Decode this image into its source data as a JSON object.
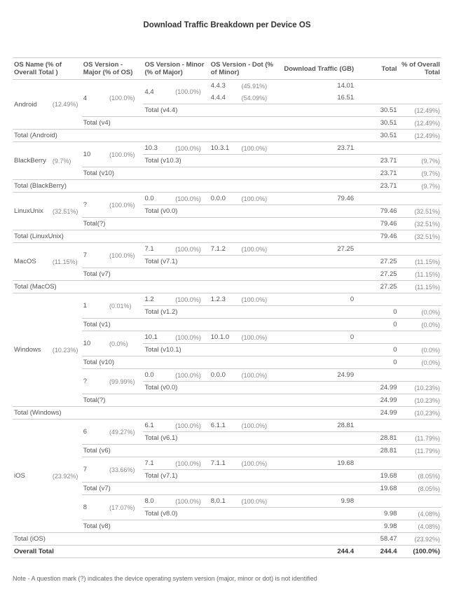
{
  "title": "Download Traffic Breakdown per Device OS",
  "headers": {
    "os_name": "OS Name  (% of Overall Total )",
    "major": "OS Version - Major (% of OS)",
    "minor": "OS Version - Minor (% of Major)",
    "dot": "OS Version - Dot (% of Minor)",
    "traffic": "Download Traffic (GB)",
    "total": "Total",
    "pct_overall": "% of Overall Total"
  },
  "chart_data": {
    "type": "table",
    "title": "Download Traffic Breakdown per Device OS",
    "os": [
      {
        "name": "Android",
        "pct_overall": "(12.49%)",
        "majors": [
          {
            "v": "4",
            "pct": "(100.0%)",
            "minors": [
              {
                "v": "4.4",
                "pct": "(100.0%)",
                "dots": [
                  {
                    "v": "4.4.3",
                    "pct": "(45.91%)",
                    "traffic": "14.01"
                  },
                  {
                    "v": "4.4.4",
                    "pct": "(54.09%)",
                    "traffic": "16.51"
                  }
                ],
                "total_label": "Total (v4.4)",
                "total_val": "30.51",
                "total_pct": "(12.49%)"
              }
            ],
            "total_label": "Total (v4)",
            "total_val": "30.51",
            "total_pct": "(12.49%)"
          }
        ],
        "total_label": "Total (Android)",
        "total_val": "30.51",
        "total_pct": "(12.49%)"
      },
      {
        "name": "BlackBerry",
        "pct_overall": "(9.7%)",
        "majors": [
          {
            "v": "10",
            "pct": "(100.0%)",
            "minors": [
              {
                "v": "10.3",
                "pct": "(100.0%)",
                "dots": [
                  {
                    "v": "10.3.1",
                    "pct": "(100.0%)",
                    "traffic": "23.71"
                  }
                ],
                "total_label": "Total (v10.3)",
                "total_val": "23.71",
                "total_pct": "(9.7%)"
              }
            ],
            "total_label": "Total (v10)",
            "total_val": "23.71",
            "total_pct": "(9.7%)"
          }
        ],
        "total_label": "Total (BlackBerry)",
        "total_val": "23.71",
        "total_pct": "(9.7%)"
      },
      {
        "name": "LinuxUnix",
        "pct_overall": "(32.51%)",
        "majors": [
          {
            "v": "?",
            "pct": "(100.0%)",
            "minors": [
              {
                "v": "0.0",
                "pct": "(100.0%)",
                "dots": [
                  {
                    "v": "0.0.0",
                    "pct": "(100.0%)",
                    "traffic": "79.46"
                  }
                ],
                "total_label": "Total (v0.0)",
                "total_val": "79.46",
                "total_pct": "(32.51%)"
              }
            ],
            "total_label": "Total(?)",
            "total_val": "79.46",
            "total_pct": "(32.51%)"
          }
        ],
        "total_label": "Total (LinuxUnix)",
        "total_val": "79.46",
        "total_pct": "(32.51%)"
      },
      {
        "name": "MacOS",
        "pct_overall": "(11.15%)",
        "majors": [
          {
            "v": "7",
            "pct": "(100.0%)",
            "minors": [
              {
                "v": "7.1",
                "pct": "(100.0%)",
                "dots": [
                  {
                    "v": "7.1.2",
                    "pct": "(100.0%)",
                    "traffic": "27.25"
                  }
                ],
                "total_label": "Total (v7.1)",
                "total_val": "27.25",
                "total_pct": "(11.15%)"
              }
            ],
            "total_label": "Total (v7)",
            "total_val": "27.25",
            "total_pct": "(11.15%)"
          }
        ],
        "total_label": "Total (MacOS)",
        "total_val": "27.25",
        "total_pct": "(11.15%)"
      },
      {
        "name": "Windows",
        "pct_overall": "(10.23%)",
        "majors": [
          {
            "v": "1",
            "pct": "(0.01%)",
            "minors": [
              {
                "v": "1.2",
                "pct": "(100.0%)",
                "dots": [
                  {
                    "v": "1.2.3",
                    "pct": "(100.0%)",
                    "traffic": "0"
                  }
                ],
                "total_label": "Total (v1.2)",
                "total_val": "0",
                "total_pct": "(0.0%)"
              }
            ],
            "total_label": "Total (v1)",
            "total_val": "0",
            "total_pct": "(0.0%)"
          },
          {
            "v": "10",
            "pct": "(0.0%)",
            "minors": [
              {
                "v": "10.1",
                "pct": "(100.0%)",
                "dots": [
                  {
                    "v": "10.1.0",
                    "pct": "(100.0%)",
                    "traffic": "0"
                  }
                ],
                "total_label": "Total (v10.1)",
                "total_val": "0",
                "total_pct": "(0.0%)"
              }
            ],
            "total_label": "Total (v10)",
            "total_val": "0",
            "total_pct": "(0.0%)"
          },
          {
            "v": "?",
            "pct": "(99.99%)",
            "minors": [
              {
                "v": "0.0",
                "pct": "(100.0%)",
                "dots": [
                  {
                    "v": "0.0.0",
                    "pct": "(100.0%)",
                    "traffic": "24.99"
                  }
                ],
                "total_label": "Total (v0.0)",
                "total_val": "24.99",
                "total_pct": "(10.23%)"
              }
            ],
            "total_label": "Total(?)",
            "total_val": "24.99",
            "total_pct": "(10.23%)"
          }
        ],
        "total_label": "Total (Windows)",
        "total_val": "24.99",
        "total_pct": "(10.23%)"
      },
      {
        "name": "iOS",
        "pct_overall": "(23.92%)",
        "majors": [
          {
            "v": "6",
            "pct": "(49.27%)",
            "minors": [
              {
                "v": "6.1",
                "pct": "(100.0%)",
                "dots": [
                  {
                    "v": "6.1.1",
                    "pct": "(100.0%)",
                    "traffic": "28.81"
                  }
                ],
                "total_label": "Total (v6.1)",
                "total_val": "28.81",
                "total_pct": "(11.79%)"
              }
            ],
            "total_label": "Total (v6)",
            "total_val": "28.81",
            "total_pct": "(11.79%)"
          },
          {
            "v": "7",
            "pct": "(33.66%)",
            "minors": [
              {
                "v": "7.1",
                "pct": "(100.0%)",
                "dots": [
                  {
                    "v": "7.1.1",
                    "pct": "(100.0%)",
                    "traffic": "19.68"
                  }
                ],
                "total_label": "Total (v7.1)",
                "total_val": "19.68",
                "total_pct": "(8.05%)"
              }
            ],
            "total_label": "Total (v7)",
            "total_val": "19.68",
            "total_pct": "(8.05%)"
          },
          {
            "v": "8",
            "pct": "(17.07%)",
            "minors": [
              {
                "v": "8.0",
                "pct": "(100.0%)",
                "dots": [
                  {
                    "v": "8.0.1",
                    "pct": "(100.0%)",
                    "traffic": "9.98"
                  }
                ],
                "total_label": "Total (v8.0)",
                "total_val": "9.98",
                "total_pct": "(4.08%)"
              }
            ],
            "total_label": "Total (v8)",
            "total_val": "9.98",
            "total_pct": "(4.08%)"
          }
        ],
        "total_label": "Total (iOS)",
        "total_val": "58.47",
        "total_pct": "(23.92%)"
      }
    ],
    "overall": {
      "label": "Overall Total",
      "traffic": "244.4",
      "total": "244.4",
      "pct": "(100.0%)"
    }
  },
  "note": "Note - A question mark (?) indicates the device operating system version (major, minor or dot) is not identified"
}
